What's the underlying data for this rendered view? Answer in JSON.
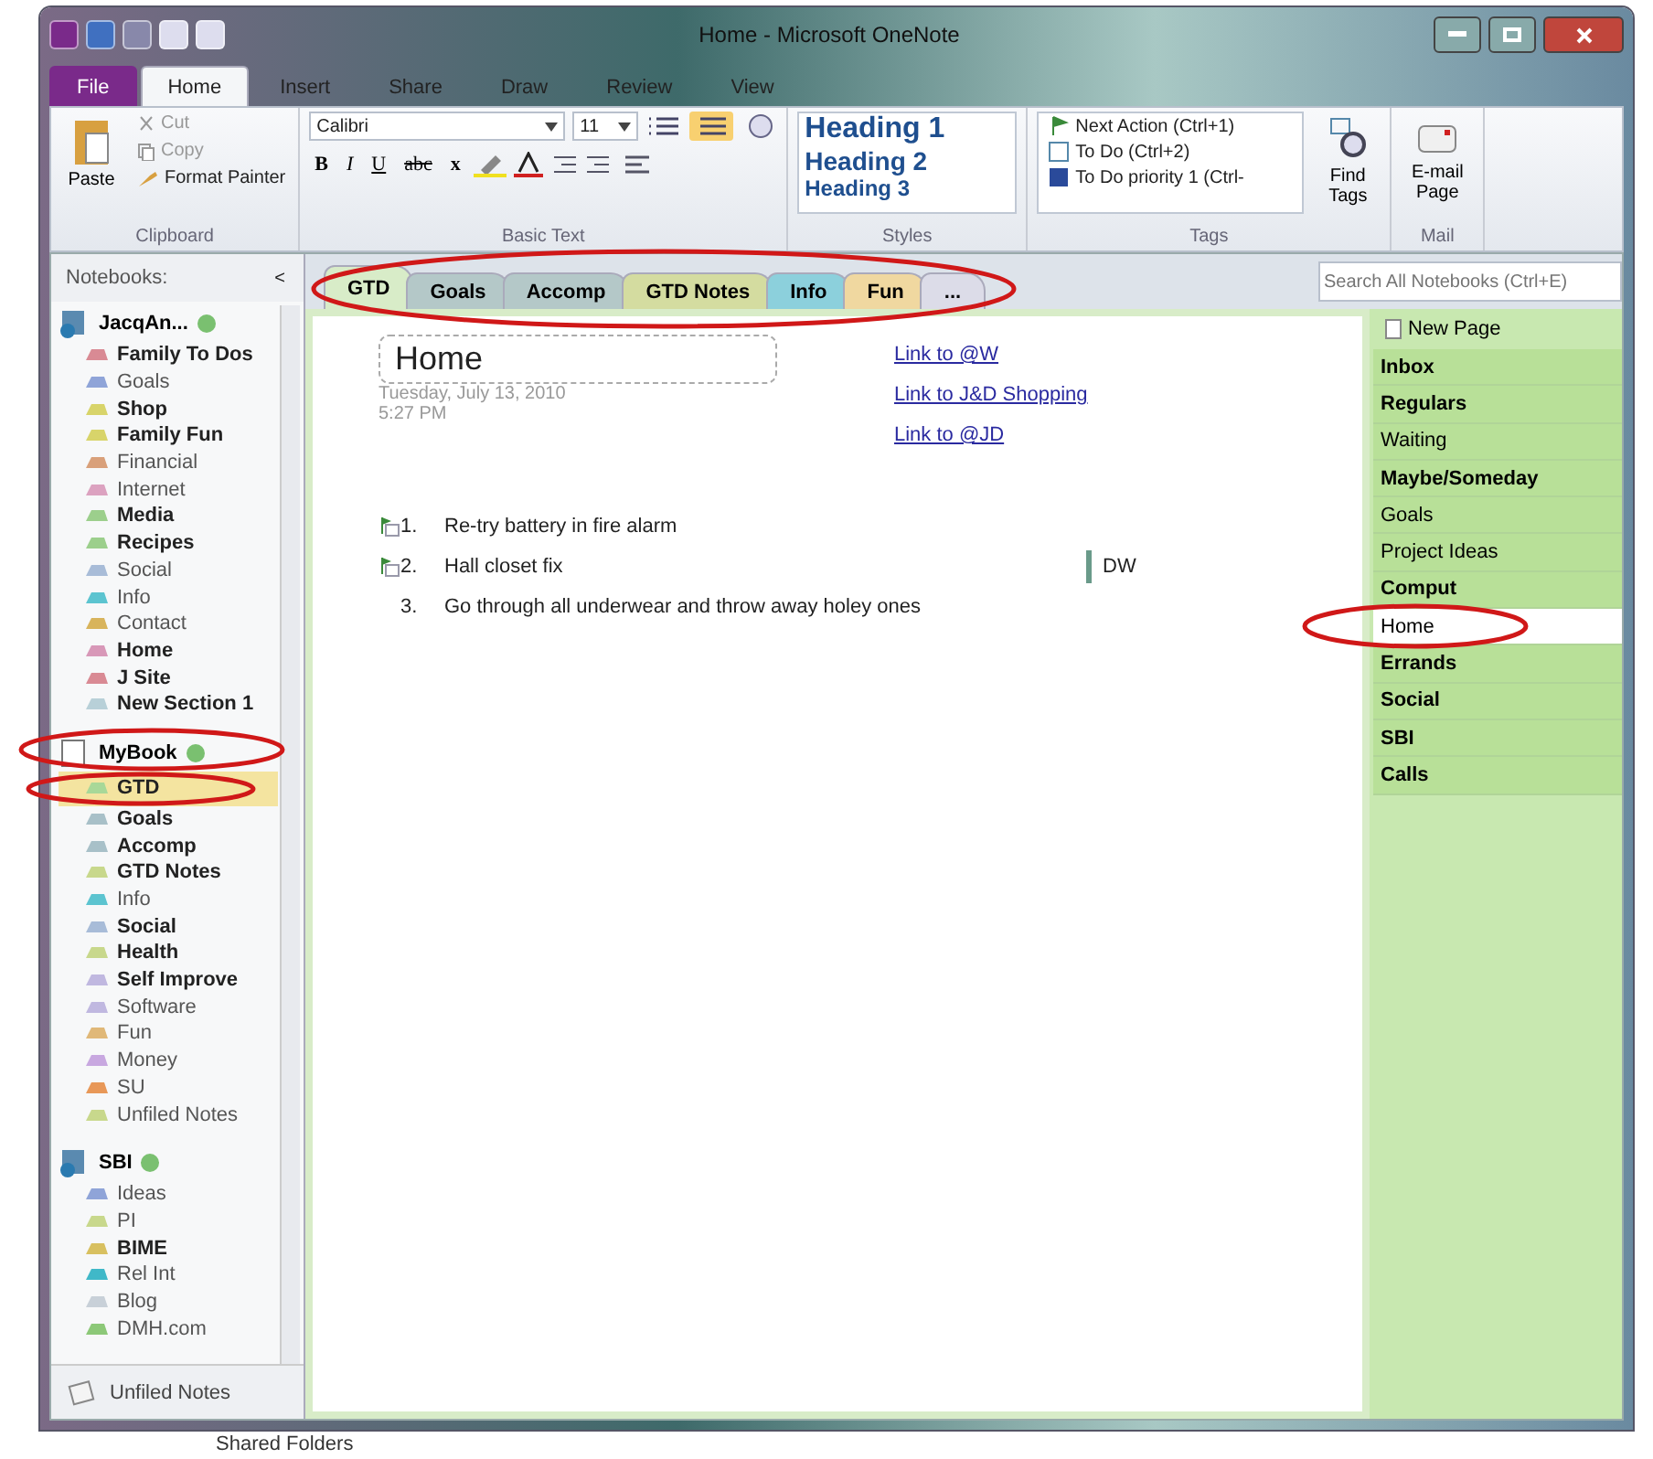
{
  "title_bar": {
    "title": "Home - Microsoft OneNote"
  },
  "ribbon_tabs": [
    {
      "label": "File",
      "kind": "file",
      "selected": false
    },
    {
      "label": "Home",
      "kind": "tab",
      "selected": true
    },
    {
      "label": "Insert",
      "kind": "tab",
      "selected": false
    },
    {
      "label": "Share",
      "kind": "tab",
      "selected": false
    },
    {
      "label": "Draw",
      "kind": "tab",
      "selected": false
    },
    {
      "label": "Review",
      "kind": "tab",
      "selected": false
    },
    {
      "label": "View",
      "kind": "tab",
      "selected": false
    }
  ],
  "ribbon": {
    "clipboard": {
      "paste": "Paste",
      "cut": "Cut",
      "copy": "Copy",
      "format_painter": "Format Painter",
      "label": "Clipboard"
    },
    "basic_text": {
      "font": "Calibri",
      "size": "11",
      "bold": "B",
      "italic": "I",
      "underline": "U",
      "strike": "abc",
      "subscript": "x",
      "label": "Basic Text"
    },
    "styles": {
      "items": [
        "Heading 1",
        "Heading 2",
        "Heading 3"
      ],
      "label": "Styles"
    },
    "tags": {
      "items": [
        {
          "label": "Next Action (Ctrl+1)",
          "kind": "flag"
        },
        {
          "label": "To Do (Ctrl+2)",
          "kind": "box"
        },
        {
          "label": "To Do priority 1 (Ctrl-",
          "kind": "priority"
        }
      ],
      "find": "Find Tags",
      "label": "Tags"
    },
    "mail": {
      "button": "E-mail Page",
      "label": "Mail"
    }
  },
  "navigation": {
    "header": "Notebooks:",
    "collapse": "<",
    "notebooks": [
      {
        "name": "JacqAn...",
        "kind": "globe",
        "sections": [
          {
            "name": "Family To Dos",
            "bold": true,
            "color": "#d98a94",
            "selected": false
          },
          {
            "name": "Goals",
            "bold": false,
            "color": "#8fa4d8",
            "selected": false
          },
          {
            "name": "Shop",
            "bold": true,
            "color": "#d8d46a",
            "selected": false
          },
          {
            "name": "Family Fun",
            "bold": true,
            "color": "#d8d46a",
            "selected": false
          },
          {
            "name": "Financial",
            "bold": false,
            "color": "#d9a07a",
            "selected": false
          },
          {
            "name": "Internet",
            "bold": false,
            "color": "#dca2c0",
            "selected": false
          },
          {
            "name": "Media",
            "bold": true,
            "color": "#9ccf8c",
            "selected": false
          },
          {
            "name": "Recipes",
            "bold": true,
            "color": "#9ccf8c",
            "selected": false
          },
          {
            "name": "Social",
            "bold": false,
            "color": "#a8bcd8",
            "selected": false
          },
          {
            "name": "Info",
            "bold": false,
            "color": "#5cc4d0",
            "selected": false
          },
          {
            "name": "Contact",
            "bold": false,
            "color": "#d8b45c",
            "selected": false
          },
          {
            "name": "Home",
            "bold": true,
            "color": "#d898b8",
            "selected": false
          },
          {
            "name": "J Site",
            "bold": true,
            "color": "#d98a94",
            "selected": false
          },
          {
            "name": "New Section 1",
            "bold": true,
            "color": "#b8d0d8",
            "selected": false
          }
        ]
      },
      {
        "name": "MyBook",
        "kind": "book",
        "sections": [
          {
            "name": "GTD",
            "bold": true,
            "color": "#a8d898",
            "selected": true
          },
          {
            "name": "Goals",
            "bold": true,
            "color": "#a8c0c8",
            "selected": false
          },
          {
            "name": "Accomp",
            "bold": true,
            "color": "#a8c0c8",
            "selected": false
          },
          {
            "name": "GTD Notes",
            "bold": true,
            "color": "#c8d88c",
            "selected": false
          },
          {
            "name": "Info",
            "bold": false,
            "color": "#5cc4d0",
            "selected": false
          },
          {
            "name": "Social",
            "bold": true,
            "color": "#a8bcd8",
            "selected": false
          },
          {
            "name": "Health",
            "bold": true,
            "color": "#c8d88c",
            "selected": false
          },
          {
            "name": "Self Improve",
            "bold": true,
            "color": "#c0b8e0",
            "selected": false
          },
          {
            "name": "Software",
            "bold": false,
            "color": "#c0b8e0",
            "selected": false
          },
          {
            "name": "Fun",
            "bold": false,
            "color": "#e0b878",
            "selected": false
          },
          {
            "name": "Money",
            "bold": false,
            "color": "#c8a8e0",
            "selected": false
          },
          {
            "name": "SU",
            "bold": false,
            "color": "#e89858",
            "selected": false
          },
          {
            "name": "Unfiled Notes",
            "bold": false,
            "color": "#c8d88c",
            "selected": false
          }
        ]
      },
      {
        "name": "SBI",
        "kind": "globe",
        "sections": [
          {
            "name": "Ideas",
            "bold": false,
            "color": "#8fa4d8",
            "selected": false
          },
          {
            "name": "PI",
            "bold": false,
            "color": "#c8d88c",
            "selected": false
          },
          {
            "name": "BIME",
            "bold": true,
            "color": "#d8c060",
            "selected": false
          },
          {
            "name": "Rel Int",
            "bold": false,
            "color": "#40b8c8",
            "selected": false
          },
          {
            "name": "Blog",
            "bold": false,
            "color": "#c8d0d8",
            "selected": false
          },
          {
            "name": "DMH.com",
            "bold": false,
            "color": "#8cc878",
            "selected": false
          }
        ]
      }
    ],
    "unfiled": "Unfiled Notes"
  },
  "section_tabs": [
    {
      "label": "GTD",
      "color": "#d8ecc8",
      "selected": true
    },
    {
      "label": "Goals",
      "color": "#b4c8c8",
      "selected": false
    },
    {
      "label": "Accomp",
      "color": "#b4c8c8",
      "selected": false
    },
    {
      "label": "GTD Notes",
      "color": "#d4dca0",
      "selected": false
    },
    {
      "label": "Info",
      "color": "#8cd0dc",
      "selected": false
    },
    {
      "label": "Fun",
      "color": "#f0d8a0",
      "selected": false
    },
    {
      "label": "...",
      "color": "#dcdce8",
      "selected": false
    }
  ],
  "search": {
    "placeholder": "Search All Notebooks (Ctrl+E)"
  },
  "page": {
    "title": "Home",
    "date": "Tuesday, July 13, 2010",
    "time": "5:27 PM",
    "links": [
      "Link to @W",
      "Link to J&D Shopping",
      "Link to @JD"
    ],
    "items": [
      {
        "number": "1.",
        "text": "Re-try battery in fire alarm",
        "tagged": true
      },
      {
        "number": "2.",
        "text": "Hall closet fix",
        "tagged": true
      },
      {
        "number": "3.",
        "text": "Go through all underwear and throw away holey ones",
        "tagged": false
      }
    ],
    "side_note": "DW"
  },
  "pages": {
    "new_page": "New Page",
    "items": [
      {
        "label": "Inbox",
        "bold": true,
        "selected": false
      },
      {
        "label": "Regulars",
        "bold": true,
        "selected": false
      },
      {
        "label": "Waiting",
        "bold": false,
        "selected": false
      },
      {
        "label": "Maybe/Someday",
        "bold": true,
        "selected": false
      },
      {
        "label": "Goals",
        "bold": false,
        "selected": false
      },
      {
        "label": "Project Ideas",
        "bold": false,
        "selected": false
      },
      {
        "label": "Comput",
        "bold": true,
        "selected": false
      },
      {
        "label": "Home",
        "bold": false,
        "selected": true
      },
      {
        "label": "Errands",
        "bold": true,
        "selected": false
      },
      {
        "label": "Social",
        "bold": true,
        "selected": false
      },
      {
        "label": "SBI",
        "bold": true,
        "selected": false
      },
      {
        "label": "Calls",
        "bold": true,
        "selected": false
      }
    ]
  },
  "desktop": {
    "label": "Shared Folders"
  }
}
